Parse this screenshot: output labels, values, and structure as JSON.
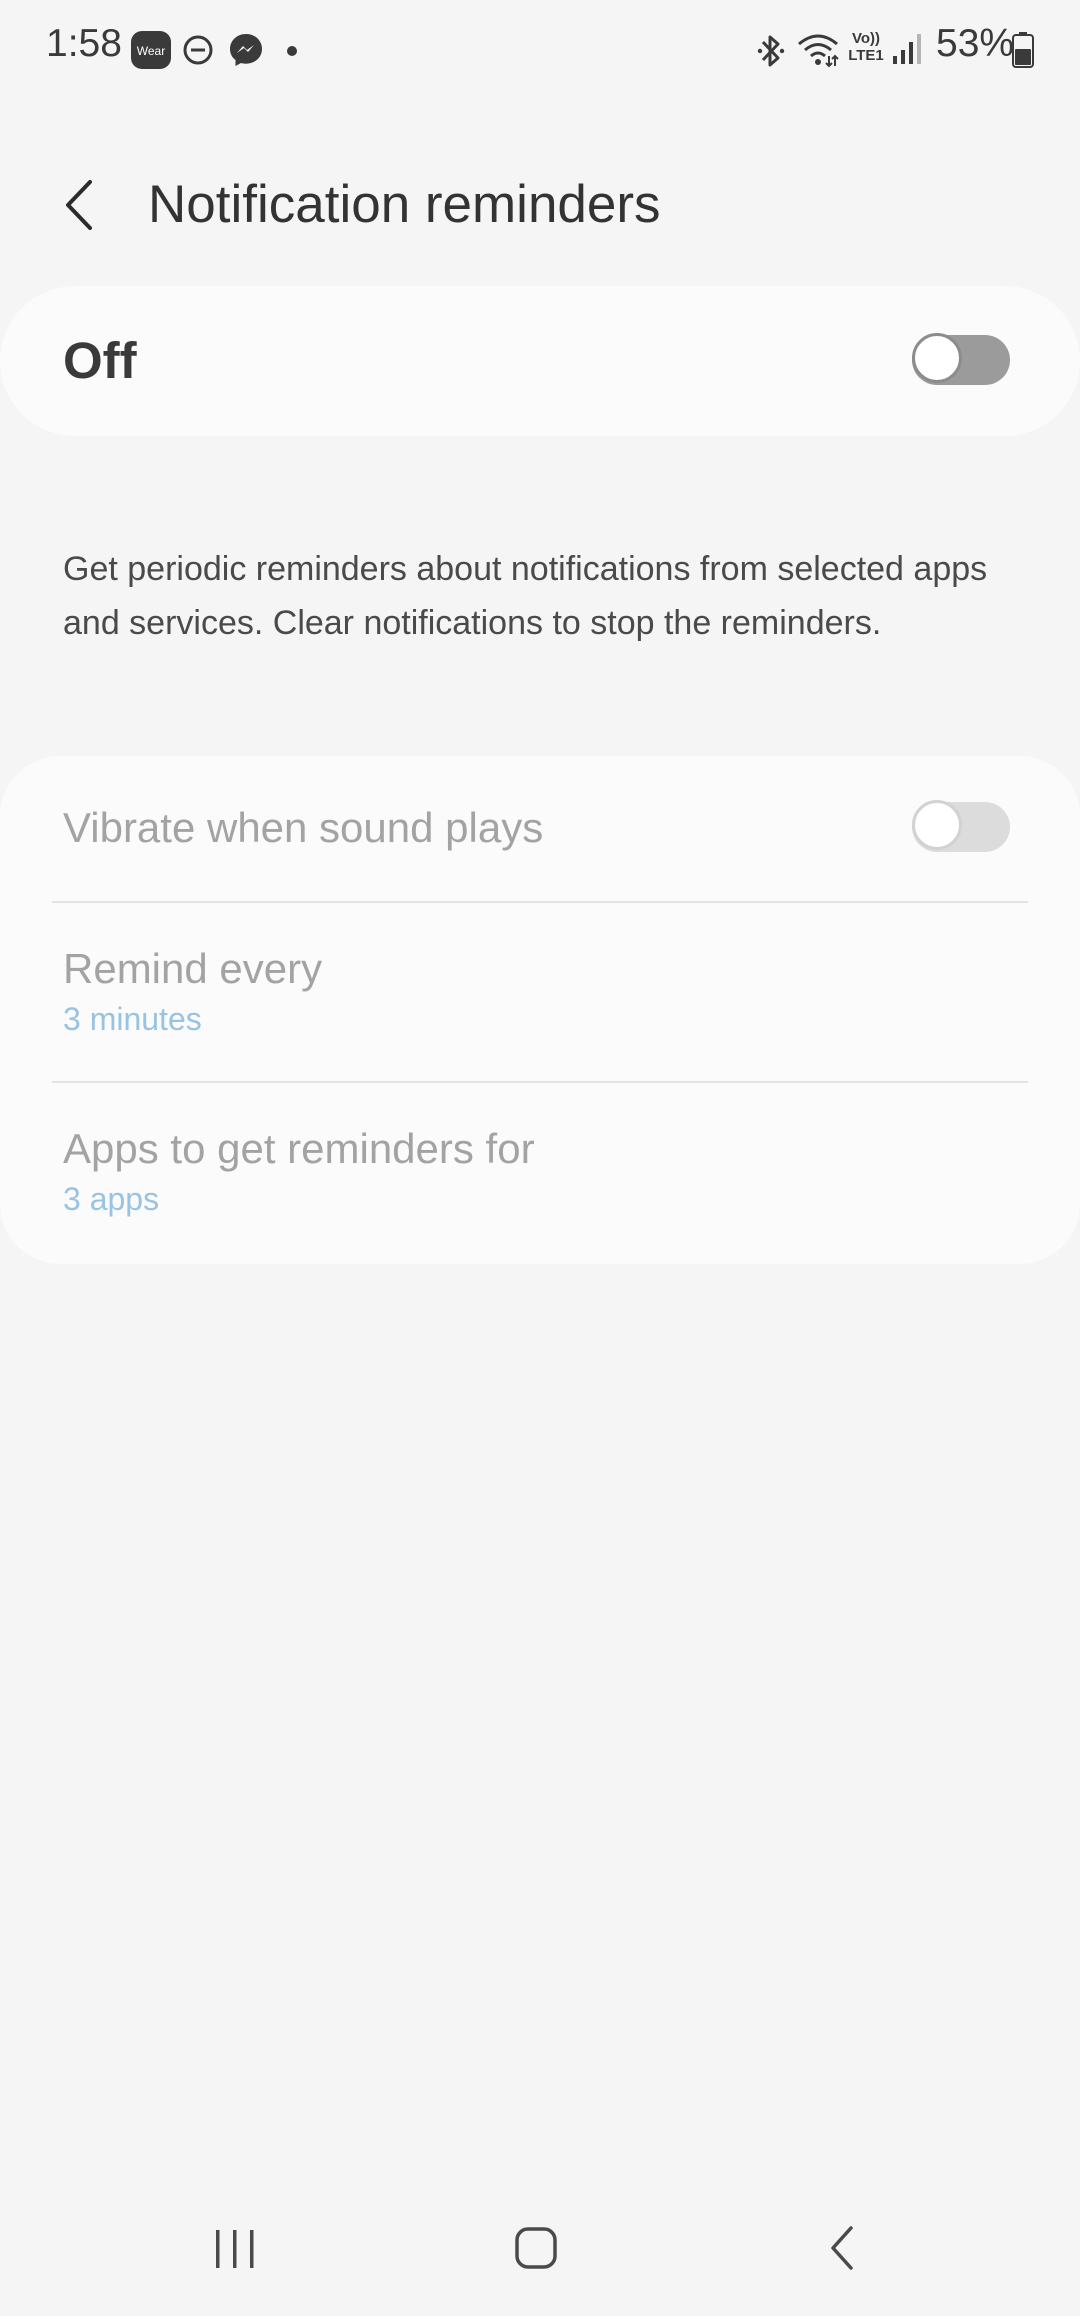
{
  "status_bar": {
    "time": "1:58",
    "wear_label": "Wear",
    "battery_percent": "53%",
    "volte_top": "Vo))",
    "volte_bottom": "LTE1"
  },
  "header": {
    "title": "Notification reminders"
  },
  "master": {
    "label": "Off",
    "state": "off"
  },
  "description": "Get periodic reminders about notifications from selected apps and services. Clear notifications to stop the reminders.",
  "settings": {
    "vibrate": {
      "label": "Vibrate when sound plays",
      "state": "off"
    },
    "remind_every": {
      "label": "Remind every",
      "value": "3 minutes"
    },
    "apps": {
      "label": "Apps to get reminders for",
      "value": "3 apps"
    }
  },
  "colors": {
    "background": "#f5f5f5",
    "card": "#fbfbfb",
    "accent_sub": "#98c3e2",
    "disabled_text": "#a3a3a3"
  }
}
